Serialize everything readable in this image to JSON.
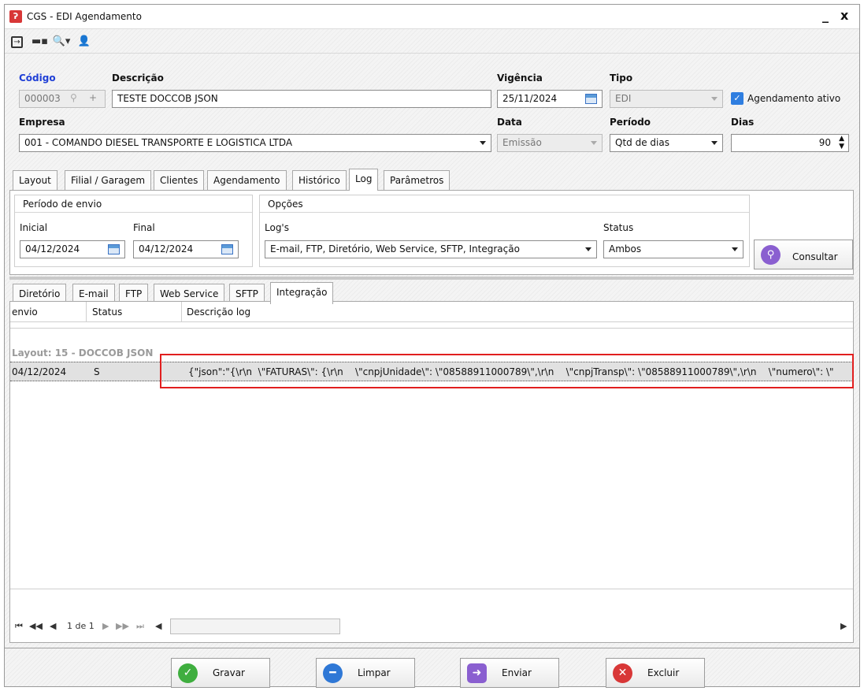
{
  "window": {
    "title": "CGS - EDI Agendamento",
    "minimize": "_",
    "close": "x"
  },
  "toolbar": {
    "icons": [
      "exit-icon",
      "keyboard-icon",
      "search-dropdown-icon",
      "users-icon"
    ]
  },
  "header": {
    "codigo_label": "Código",
    "codigo_value": "000003",
    "descricao_label": "Descrição",
    "descricao_value": "TESTE DOCCOB JSON",
    "vigencia_label": "Vigência",
    "vigencia_value": "25/11/2024",
    "tipo_label": "Tipo",
    "tipo_value": "EDI",
    "agendamento_label": "Agendamento ativo",
    "agendamento_checked": true,
    "empresa_label": "Empresa",
    "empresa_value": "001 - COMANDO DIESEL TRANSPORTE E LOGISTICA LTDA",
    "data_label": "Data",
    "data_value": "Emissão",
    "periodo_label": "Período",
    "periodo_value": "Qtd de dias",
    "dias_label": "Dias",
    "dias_value": "90"
  },
  "tabs": [
    "Layout",
    "Filial / Garagem",
    "Clientes",
    "Agendamento",
    "Histórico",
    "Log",
    "Parâmetros"
  ],
  "active_tab": "Log",
  "log": {
    "periodo_group": "Período de envio",
    "inicial_label": "Inicial",
    "inicial_value": "04/12/2024",
    "final_label": "Final",
    "final_value": "04/12/2024",
    "opcoes_group": "Opções",
    "logs_label": "Log's",
    "logs_value": "E-mail, FTP, Diretório, Web Service, SFTP, Integração",
    "status_label": "Status",
    "status_value": "Ambos",
    "consultar_label": "Consultar"
  },
  "subtabs": [
    "Diretório",
    "E-mail",
    "FTP",
    "Web Service",
    "SFTP",
    "Integração"
  ],
  "active_subtab": "Integração",
  "grid": {
    "columns": [
      "envio",
      "Status",
      "Descrição log"
    ],
    "group_header": "Layout: 15 - DOCCOB JSON",
    "rows": [
      {
        "envio": "04/12/2024",
        "status": "S",
        "descricao": "{\"json\":\"{\\r\\n  \\\"FATURAS\\\": {\\r\\n    \\\"cnpjUnidade\\\": \\\"08588911000789\\\",\\r\\n    \\\"cnpjTransp\\\": \\\"08588911000789\\\",\\r\\n    \\\"numero\\\": \\\""
      }
    ]
  },
  "pager": {
    "text": "1 de 1"
  },
  "buttons": {
    "gravar": "Gravar",
    "limpar": "Limpar",
    "enviar": "Enviar",
    "excluir": "Excluir"
  }
}
